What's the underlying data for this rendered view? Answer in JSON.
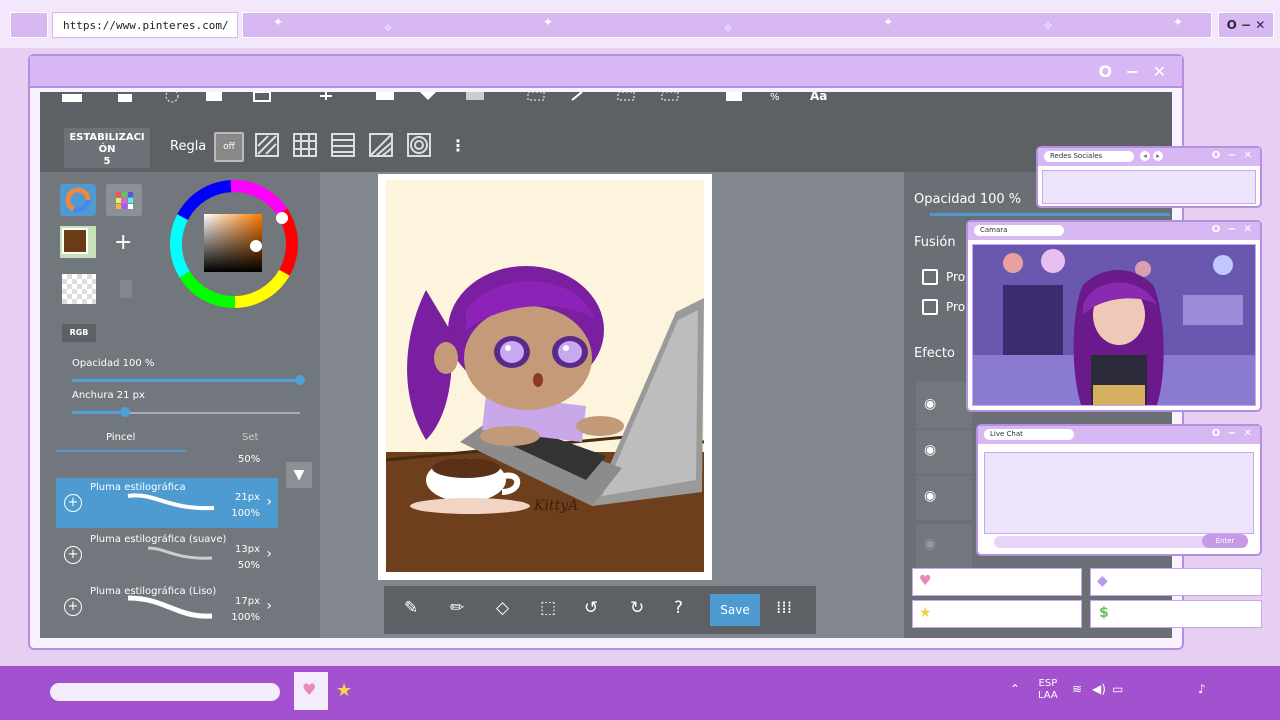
{
  "browser": {
    "url": "https://www.pinteres.com/",
    "window_controls": "O − ✕"
  },
  "main_window": {
    "controls": "O − ✕"
  },
  "app": {
    "stabilization_label": "ESTABILIZACI ÓN",
    "stabilization_value": "5",
    "ruler_label": "Regla",
    "ruler_off": "off",
    "color_mode": "RGB",
    "opacity_label": "Opacidad",
    "opacity_value": "100 %",
    "width_label": "Anchura",
    "width_value": "21  px",
    "tab_brush": "Pincel",
    "tab_set": "Set",
    "set_percent": "50%",
    "brushes": [
      {
        "name": "Pluma estilográfica",
        "size": "21px",
        "opacity": "100%",
        "selected": true
      },
      {
        "name": "Pluma estilográfica (suave)",
        "size": "13px",
        "opacity": "50%",
        "selected": false
      },
      {
        "name": "Pluma estilográfica (Liso)",
        "size": "17px",
        "opacity": "100%",
        "selected": false
      }
    ],
    "right_panel": {
      "opacity_label": "Opacidad",
      "opacity_value": "100 %",
      "blend_label": "Fusión",
      "option1": "Pro",
      "option2": "Pro",
      "effect_label": "Efecto"
    },
    "save_label": "Save",
    "canvas_signature": "KittyA"
  },
  "overlays": {
    "social": {
      "title": "Redes Sociales"
    },
    "camera": {
      "title": "Camara"
    },
    "chat": {
      "title": "Live Chat",
      "enter": "Enter"
    }
  },
  "taskbar": {
    "lang_line1": "ESP",
    "lang_line2": "LAA"
  },
  "colors": {
    "accent_purple": "#a252cf",
    "lavender": "#d8b8f2",
    "selected_brush": "#4d9bd0",
    "current_color": "#6b3a17"
  }
}
